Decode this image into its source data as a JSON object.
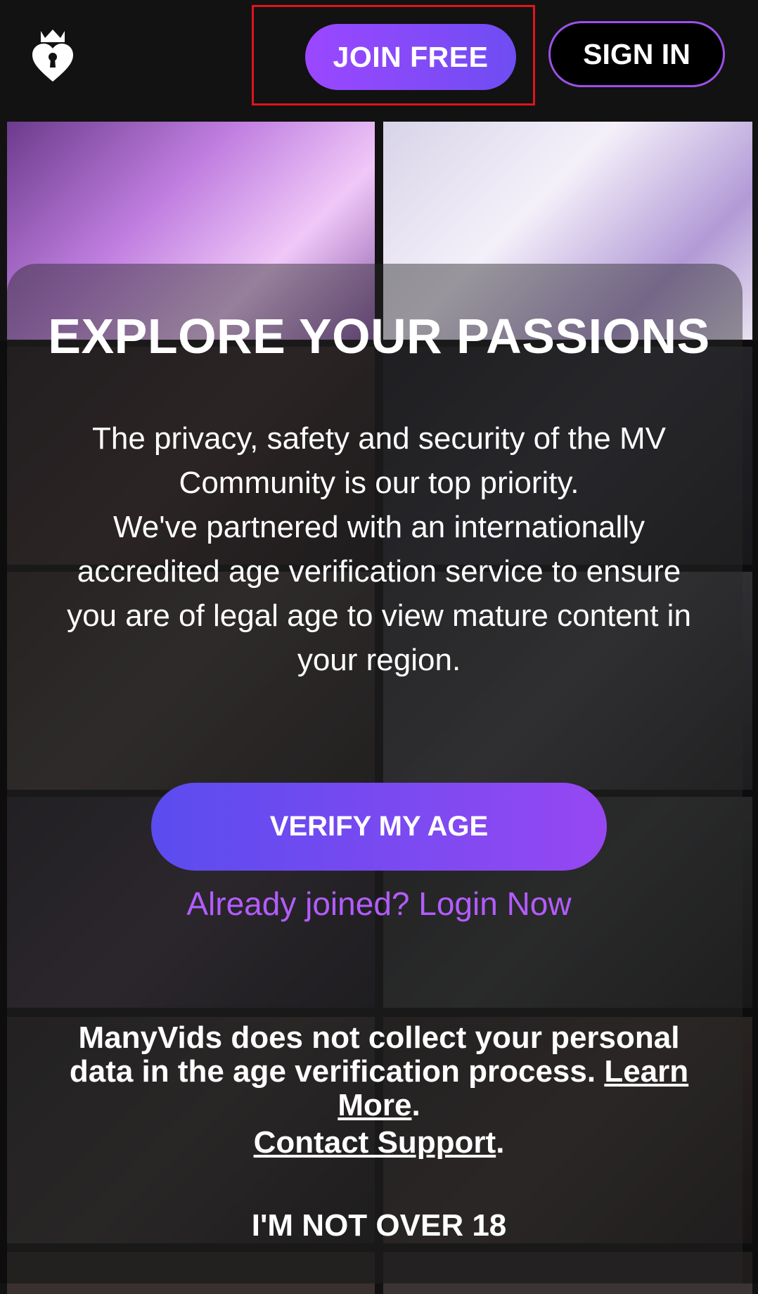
{
  "header": {
    "logo_icon": "heart-keyhole-crown-icon",
    "join_label": "JOIN FREE",
    "signin_label": "SIGN IN"
  },
  "main": {
    "title": "EXPLORE YOUR PASSIONS",
    "desc_line1": "The privacy, safety and security of the MV Community is our top priority.",
    "desc_line2": "We've partnered with an internationally accredited age verification service to ensure you are of legal age to view mature content in your region.",
    "verify_label": "VERIFY MY AGE",
    "login_link": "Already joined? Login Now",
    "privacy_text": "ManyVids does not collect your personal data in the age verification process.",
    "learn_more": "Learn More",
    "contact_support": "Contact Support",
    "period": ".",
    "not_over_18": "I'M NOT OVER 18"
  },
  "colors": {
    "accent_purple": "#9b47ff",
    "accent_blue": "#5a4cef",
    "link_purple": "#b35cff",
    "highlight_red": "#e0131b"
  }
}
